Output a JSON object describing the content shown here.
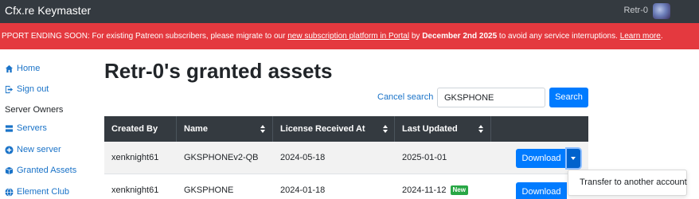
{
  "app": {
    "title": "Cfx.re Keymaster",
    "user_name": "Retr-0"
  },
  "alert": {
    "prefix": "PPORT ENDING SOON: For existing Patreon subscribers, please migrate to our ",
    "link1": "new subscription platform in Portal",
    "middle": " by ",
    "date": "December 2nd 2025",
    "suffix": " to avoid any service interruptions. ",
    "link2": "Learn more",
    "end": "."
  },
  "sidebar": {
    "items": [
      {
        "label": "Home",
        "icon": "home-icon"
      },
      {
        "label": "Sign out",
        "icon": "sign-out-icon"
      }
    ],
    "section_heading": "Server Owners",
    "owner_items": [
      {
        "label": "Servers",
        "icon": "servers-icon"
      },
      {
        "label": "New server",
        "icon": "plus-circle-icon"
      },
      {
        "label": "Granted Assets",
        "icon": "box-icon"
      },
      {
        "label": "Element Club",
        "icon": "globe-icon"
      }
    ]
  },
  "main": {
    "page_title": "Retr-0's granted assets",
    "cancel_search": "Cancel search",
    "search_value": "GKSPHONE",
    "search_button": "Search"
  },
  "table": {
    "headers": [
      "Created By",
      "Name",
      "License Received At",
      "Last Updated",
      ""
    ],
    "rows": [
      {
        "created_by": "xenknight61",
        "name": "GKSPHONEv2-QB",
        "received": "2024-05-18",
        "updated": "2025-01-01",
        "badge": "",
        "action": "Download"
      },
      {
        "created_by": "xenknight61",
        "name": "GKSPHONE",
        "received": "2024-01-18",
        "updated": "2024-11-12",
        "badge": "New",
        "action": "Download"
      }
    ]
  },
  "dropdown": {
    "item": "Transfer to another account"
  },
  "colors": {
    "navbar": "#343a40",
    "alert": "#e4393f",
    "primary": "#007bff",
    "link": "#1a73c8",
    "badge": "#28a745"
  }
}
